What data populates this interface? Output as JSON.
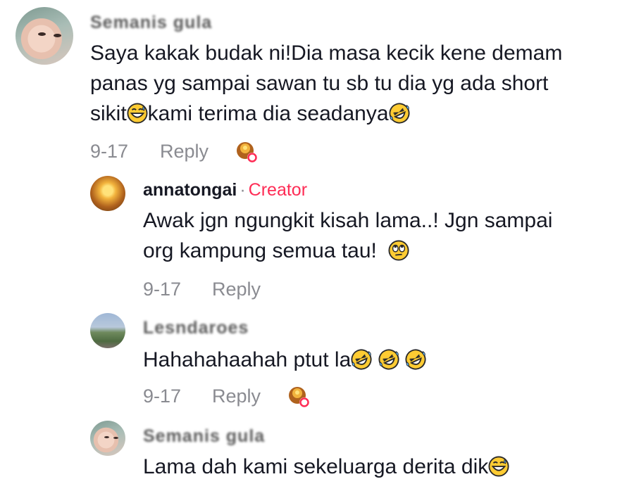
{
  "comments": [
    {
      "username": "Semanis gula",
      "lines": [
        "Saya kakak budak ni!Dia masa kecik kene demam",
        "panas yg sampai sawan tu sb tu dia yg ada short",
        "sikit",
        "kami terima dia seadanya"
      ],
      "date": "9-17",
      "reply_label": "Reply"
    },
    {
      "username": "annatongai",
      "separator": "·",
      "badge": "Creator",
      "lines": [
        "Awak jgn ngungkit kisah lama..! Jgn sampai",
        "org kampung semua tau! "
      ],
      "date": "9-17",
      "reply_label": "Reply"
    },
    {
      "username": "Lesndaroes",
      "lines": [
        "Hahahahaahah ptut la"
      ],
      "date": "9-17",
      "reply_label": "Reply"
    },
    {
      "username": "Semanis gula",
      "lines": [
        "Lama dah kami sekeluarga derita dik"
      ],
      "date": "",
      "reply_label": ""
    }
  ],
  "icons": {
    "grin_sweat": "grinning-sweat-emoji-icon",
    "rofl": "rolling-on-floor-laughing-emoji-icon",
    "eye_roll": "face-with-rolling-eyes-emoji-icon",
    "creator_like": "creator-liked-badge-icon"
  },
  "colors": {
    "creator": "#fe2c55",
    "meta": "#8a8b91",
    "text": "#161823"
  }
}
